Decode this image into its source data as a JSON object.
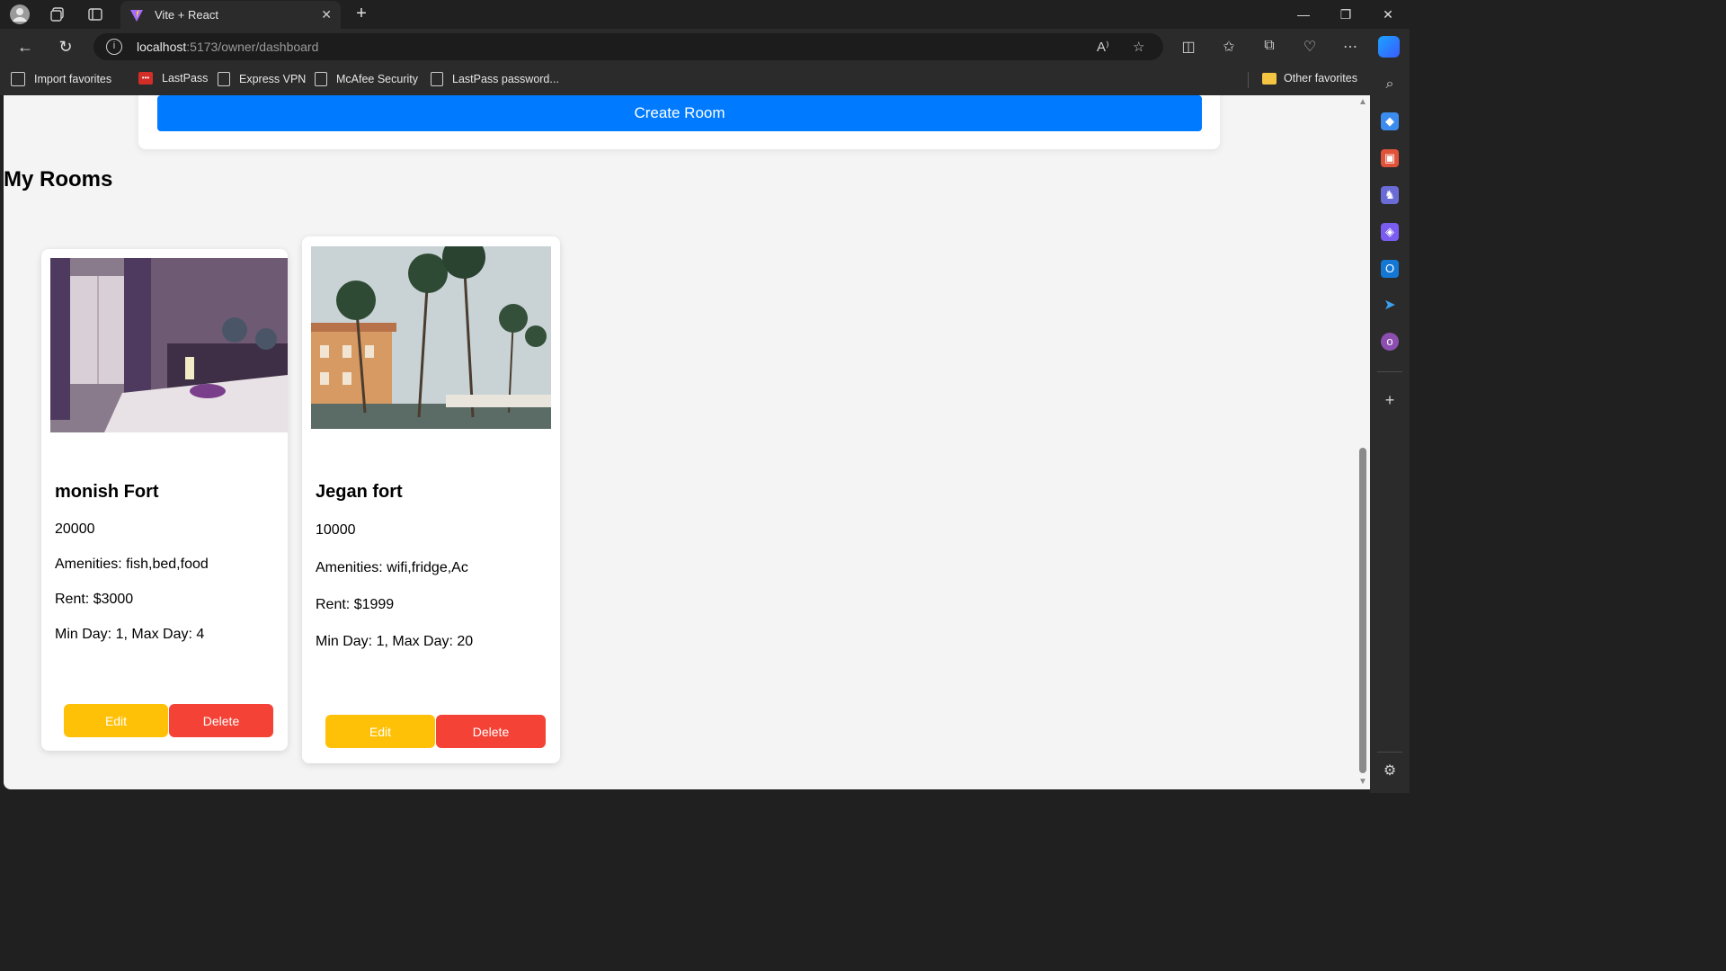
{
  "browser": {
    "tab_title": "Vite + React",
    "url_host": "localhost",
    "url_path": ":5173/owner/dashboard",
    "bookmarks": [
      "Import favorites",
      "LastPass",
      "Express VPN",
      "McAfee Security",
      "LastPass password..."
    ],
    "other_favorites": "Other favorites",
    "read_aloud": "A⁾"
  },
  "page": {
    "create_button": "Create Room",
    "section_title": "My Rooms"
  },
  "rooms": [
    {
      "name": "monish Fort",
      "price": "20000",
      "amenities": "Amenities: fish,bed,food",
      "rent": "Rent: $3000",
      "days": "Min Day: 1, Max Day: 4",
      "edit": "Edit",
      "delete": "Delete"
    },
    {
      "name": "Jegan fort",
      "price": "10000",
      "amenities": "Amenities: wifi,fridge,Ac",
      "rent": "Rent: $1999",
      "days": "Min Day: 1, Max Day: 20",
      "edit": "Edit",
      "delete": "Delete"
    }
  ],
  "colors": {
    "primary": "#007bff",
    "edit": "#ffc107",
    "delete": "#f44336"
  }
}
